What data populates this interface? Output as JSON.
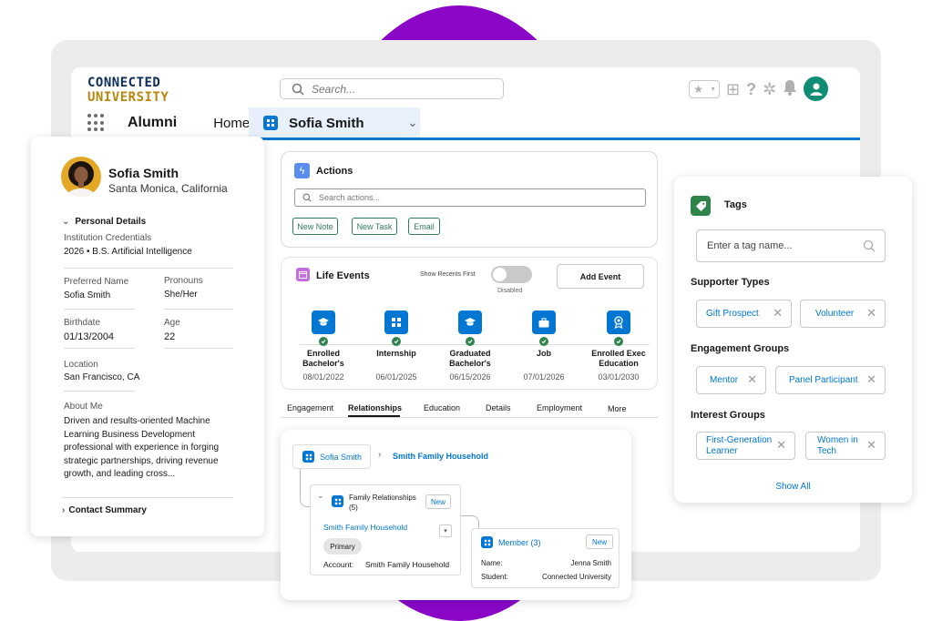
{
  "app": {
    "logo_line1": "CONNECTED",
    "logo_line2": "UNIVERSITY",
    "search_placeholder": "Search...",
    "app_name": "Alumni",
    "nav_home": "Home",
    "record_tab": "Sofia Smith"
  },
  "profile": {
    "name": "Sofia Smith",
    "location": "Santa Monica, California",
    "section_personal": "Personal Details",
    "institution_credentials_label": "Institution Credentials",
    "institution_credentials_value": "2026 • B.S. Artificial Intelligence",
    "preferred_name_label": "Preferred Name",
    "preferred_name_value": "Sofia Smith",
    "pronouns_label": "Pronouns",
    "pronouns_value": "She/Her",
    "birthdate_label": "Birthdate",
    "birthdate_value": "01/13/2004",
    "age_label": "Age",
    "age_value": "22",
    "location_label": "Location",
    "location_value": "San Francisco, CA",
    "about_label": "About Me",
    "about_value": "Driven and results-oriented Machine Learning Business Development professional with experience in forging strategic partnerships, driving revenue growth, and leading cross...",
    "section_contact": "Contact Summary"
  },
  "actions": {
    "title": "Actions",
    "search_placeholder": "Search actions...",
    "buttons": [
      "New Note",
      "New Task",
      "Email"
    ]
  },
  "life_events": {
    "title": "Life Events",
    "toggle_label": "Show Recents First",
    "toggle_state": "Disabled",
    "add_button": "Add Event",
    "events": [
      {
        "name": "Enrolled Bachelor's",
        "date": "08/01/2022",
        "icon": "graduation-cap-icon"
      },
      {
        "name": "Internship",
        "date": "06/01/2025",
        "icon": "building-icon"
      },
      {
        "name": "Graduated Bachelor's",
        "date": "06/15/2026",
        "icon": "graduation-cap-icon"
      },
      {
        "name": "Job",
        "date": "07/01/2026",
        "icon": "briefcase-icon"
      },
      {
        "name": "Enrolled Exec Education",
        "date": "03/01/2030",
        "icon": "award-icon"
      }
    ]
  },
  "tabs": [
    "Engagement",
    "Relationships",
    "Education",
    "Details",
    "Employment",
    "More"
  ],
  "relationships": {
    "root": "Sofia Smith",
    "household_link": "Smith Family Household",
    "family_title": "Family Relationships (5)",
    "new_label": "New",
    "household_name": "Smith Family Household",
    "primary_badge": "Primary",
    "account_label": "Account:",
    "account_value": "Smith Family Household",
    "member_title": "Member (3)",
    "member_new": "New",
    "member_name_label": "Name:",
    "member_name_value": "Jenna Smith",
    "member_student_label": "Student:",
    "member_student_value": "Connected University"
  },
  "tags": {
    "title": "Tags",
    "input_placeholder": "Enter a tag name...",
    "supporter_title": "Supporter Types",
    "supporter": [
      "Gift Prospect",
      "Volunteer"
    ],
    "engagement_title": "Engagement Groups",
    "engagement": [
      "Mentor",
      "Panel Participant"
    ],
    "interest_title": "Interest Groups",
    "interest": [
      "First-Generation Learner",
      "Women in Tech"
    ],
    "show_all": "Show All"
  },
  "colors": {
    "brand_blue": "#0176d3",
    "accent_purple": "#8a07c8",
    "success_green": "#2e844a",
    "action_green": "#2e7d5b"
  }
}
